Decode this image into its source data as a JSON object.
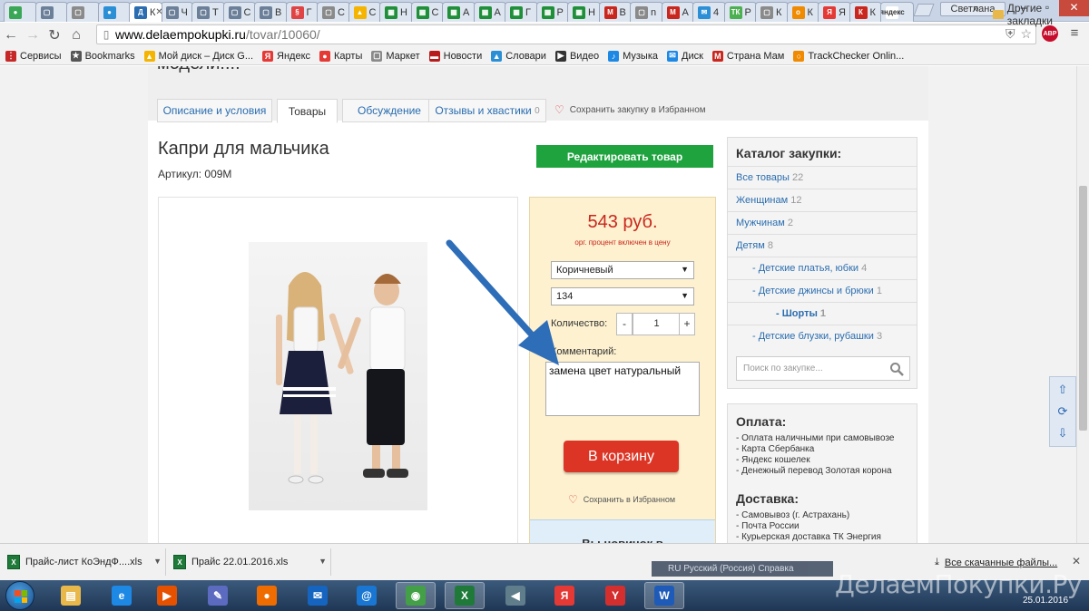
{
  "browser": {
    "tabs": [
      {
        "title": "",
        "color": "#3aa757",
        "glyph": "●"
      },
      {
        "title": "",
        "color": "#6b7f99",
        "glyph": "▢"
      },
      {
        "title": "",
        "color": "#8a8a8a",
        "glyph": "▢"
      },
      {
        "title": "",
        "color": "#2b8fd6",
        "glyph": "●"
      },
      {
        "title": "К",
        "color": "#2a6db0",
        "glyph": "Д",
        "active": true
      },
      {
        "title": "Ч",
        "color": "#6b7f99",
        "glyph": "▢"
      },
      {
        "title": "Т",
        "color": "#6b7f99",
        "glyph": "▢"
      },
      {
        "title": "С",
        "color": "#6b7f99",
        "glyph": "▢"
      },
      {
        "title": "В",
        "color": "#6b7f99",
        "glyph": "▢"
      },
      {
        "title": "Г",
        "color": "#e04343",
        "glyph": "§"
      },
      {
        "title": "С",
        "color": "#8a8a8a",
        "glyph": "▢"
      },
      {
        "title": "С",
        "color": "#f4b400",
        "glyph": "▲"
      },
      {
        "title": "Н",
        "color": "#1f8f3a",
        "glyph": "▦"
      },
      {
        "title": "С",
        "color": "#1f8f3a",
        "glyph": "▦"
      },
      {
        "title": "А",
        "color": "#1f8f3a",
        "glyph": "▦"
      },
      {
        "title": "А",
        "color": "#1f8f3a",
        "glyph": "▦"
      },
      {
        "title": "Г",
        "color": "#1f8f3a",
        "glyph": "▦"
      },
      {
        "title": "Р",
        "color": "#1f8f3a",
        "glyph": "▦"
      },
      {
        "title": "Н",
        "color": "#1f8f3a",
        "glyph": "▦"
      },
      {
        "title": "В",
        "color": "#c9261d",
        "glyph": "M"
      },
      {
        "title": "n",
        "color": "#8a8a8a",
        "glyph": "▢"
      },
      {
        "title": "А",
        "color": "#c9261d",
        "glyph": "M"
      },
      {
        "title": "4",
        "color": "#2b8fd6",
        "glyph": "✉"
      },
      {
        "title": "Р",
        "color": "#4caf50",
        "glyph": "ТК"
      },
      {
        "title": "К",
        "color": "#8a8a8a",
        "glyph": "▢"
      },
      {
        "title": "К",
        "color": "#f08a00",
        "glyph": "о"
      },
      {
        "title": "Я",
        "color": "#e53935",
        "glyph": "Я"
      },
      {
        "title": "К",
        "color": "#c9261d",
        "glyph": "К"
      },
      {
        "title": "",
        "color": "#ffffff",
        "glyph": "яндекс"
      }
    ],
    "profile": "Светлана",
    "url_host": "www.delaempokupki.ru",
    "url_path": "/tovar/10060/",
    "abp_label": "ABP",
    "bookmarks": [
      {
        "label": "Сервисы",
        "icon": "apps-icon",
        "color": "#c62828",
        "glyph": "⋮"
      },
      {
        "label": "Bookmarks",
        "icon": "star-icon",
        "color": "#555555",
        "glyph": "★"
      },
      {
        "label": "Мой диск – Диск G...",
        "icon": "drive-icon",
        "color": "#f4b400",
        "glyph": "▲"
      },
      {
        "label": "Яндекс",
        "icon": "yandex-icon",
        "color": "#e53935",
        "glyph": "Я"
      },
      {
        "label": "Карты",
        "icon": "map-pin-icon",
        "color": "#e53935",
        "glyph": "●"
      },
      {
        "label": "Маркет",
        "icon": "market-icon",
        "color": "#8a8a8a",
        "glyph": "▢"
      },
      {
        "label": "Новости",
        "icon": "news-icon",
        "color": "#b71c1c",
        "glyph": "▬"
      },
      {
        "label": "Словари",
        "icon": "dictionary-icon",
        "color": "#2b8fd6",
        "glyph": "▲"
      },
      {
        "label": "Видео",
        "icon": "video-icon",
        "color": "#333333",
        "glyph": "▶"
      },
      {
        "label": "Музыка",
        "icon": "music-icon",
        "color": "#1e88e5",
        "glyph": "♪"
      },
      {
        "label": "Диск",
        "icon": "disk-icon",
        "color": "#1e88e5",
        "glyph": "✉"
      },
      {
        "label": "Страна Мам",
        "icon": "strana-mam-icon",
        "color": "#c9261d",
        "glyph": "M"
      },
      {
        "label": "TrackChecker Onlin...",
        "icon": "trackchecker-icon",
        "color": "#f08a00",
        "glyph": "○"
      }
    ],
    "bookmarks_more": "»",
    "bookmarks_other": "Другие закладки"
  },
  "page": {
    "partial_heading": "модели!!!!",
    "tabs": [
      {
        "label": "Описание и условия"
      },
      {
        "label": "Товары",
        "active": true
      },
      {
        "label": "Обсуждение"
      },
      {
        "label": "Отзывы и хвастики",
        "count": "0"
      }
    ],
    "favorite_link": "Сохранить закупку в Избранном",
    "product": {
      "title": "Капри для мальчика",
      "article": "Артикул: 009М",
      "edit_button": "Редактировать товар"
    },
    "buy": {
      "price": "543 руб.",
      "price_note": "орг. процент включен в цену",
      "color_select": "Коричневый",
      "size_select": "134",
      "qty_label": "Количество:",
      "qty_minus": "-",
      "qty_value": "1",
      "qty_plus": "+",
      "comment_label": "Комментарий:",
      "comment_value": "замена цвет натуральный",
      "cart_button": "В корзину",
      "favorite": "Сохранить в Избранном",
      "newbie": "Вы новичок в"
    },
    "catalog": {
      "title": "Каталог закупки:",
      "items": [
        {
          "label": "Все товары",
          "count": "22"
        },
        {
          "label": "Женщинам",
          "count": "12"
        },
        {
          "label": "Мужчинам",
          "count": "2"
        },
        {
          "label": "Детям",
          "count": "8"
        },
        {
          "label": "- Детские платья, юбки",
          "count": "4"
        },
        {
          "label": "- Детские джинсы и брюки",
          "count": "1"
        },
        {
          "label": "- Шорты",
          "count": "1",
          "bold": true
        },
        {
          "label": "- Детские блузки, рубашки",
          "count": "3"
        }
      ],
      "search_placeholder": "Поиск по закупке..."
    },
    "payment": {
      "title": "Оплата:",
      "lines": [
        "- Оплата наличными при самовывозе",
        "- Карта Сбербанка",
        "- Яндекс кошелек",
        "- Денежный перевод Золотая корона"
      ]
    },
    "delivery": {
      "title": "Доставка:",
      "lines": [
        "- Самовывоз (г. Астрахань)",
        "- Почта России",
        "- Курьерская доставка ТК Энергия"
      ]
    }
  },
  "downloads": {
    "items": [
      {
        "name": "Прайс-лист КоЭндФ....xls"
      },
      {
        "name": "Прайс 22.01.2016.xls"
      }
    ],
    "show_all": "Все скачанные файлы...",
    "language_bar": "RU Русский (Россия)    Справка"
  },
  "taskbar": {
    "apps": [
      {
        "name": "explorer-icon",
        "color": "#e8b94a",
        "glyph": "▤"
      },
      {
        "name": "ie-icon",
        "color": "#1e88e5",
        "glyph": "e"
      },
      {
        "name": "media-player-icon",
        "color": "#e65100",
        "glyph": "▶"
      },
      {
        "name": "tools-icon",
        "color": "#5c6bc0",
        "glyph": "✎"
      },
      {
        "name": "firefox-icon",
        "color": "#ef6c00",
        "glyph": "●"
      },
      {
        "name": "mail-icon",
        "color": "#1565c0",
        "glyph": "✉"
      },
      {
        "name": "email-client-icon",
        "color": "#1976d2",
        "glyph": "@"
      },
      {
        "name": "chrome-icon",
        "color": "#43a047",
        "glyph": "◉",
        "active": true
      },
      {
        "name": "excel-icon",
        "color": "#1f7a3a",
        "glyph": "X",
        "active": true
      },
      {
        "name": "speaker-icon",
        "color": "#607d8b",
        "glyph": "◀"
      },
      {
        "name": "yandex-icon",
        "color": "#e53935",
        "glyph": "Я"
      },
      {
        "name": "yandex-browser-icon",
        "color": "#d32f2f",
        "glyph": "Y"
      },
      {
        "name": "word-icon",
        "color": "#1e5bb8",
        "glyph": "W",
        "active": true
      }
    ],
    "watermark": "ДелаемПокупки.Ру",
    "date": "25.01.2016"
  }
}
